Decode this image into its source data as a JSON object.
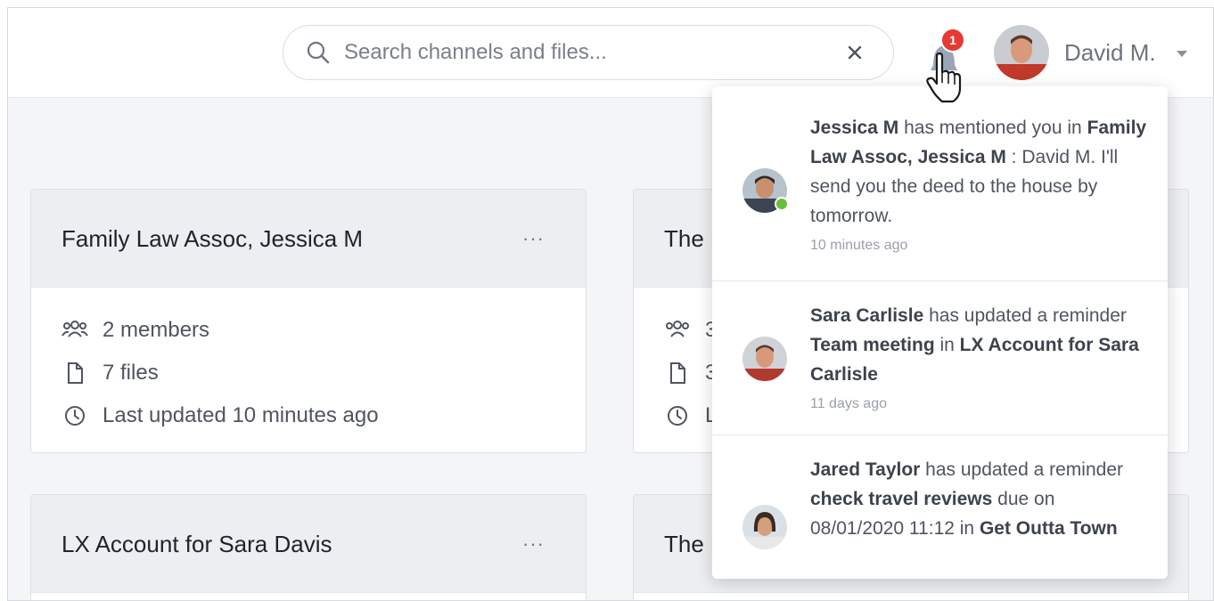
{
  "search": {
    "placeholder": "Search channels and files..."
  },
  "notifications": {
    "count": "1"
  },
  "user": {
    "name": "David M."
  },
  "cards": [
    {
      "title": "Family Law Assoc, Jessica M",
      "more": "···",
      "members": "2 members",
      "files": "7 files",
      "updated": "Last updated 10 minutes ago"
    },
    {
      "title": "The",
      "more": "···",
      "members": "3",
      "files": "3",
      "updated": "L"
    },
    {
      "title": "LX Account for Sara Davis",
      "more": "···"
    },
    {
      "title": "The"
    }
  ],
  "dropdown": {
    "items": [
      {
        "actor": "Jessica M",
        "t1": " has mentioned you in ",
        "target": "Family Law Assoc, Jessica M",
        "t2": " : David M. I'll send you the deed to the house by tomorrow.",
        "time": "10 minutes ago"
      },
      {
        "actor": "Sara Carlisle",
        "t1": " has updated a reminder ",
        "target": "Team meeting",
        "t2": " in ",
        "target2": "LX Account for Sara Carlisle",
        "time": "11 days ago"
      },
      {
        "actor": "Jared Taylor",
        "t1": " has updated a reminder ",
        "target": "check travel reviews",
        "t2": " due on 08/01/2020 11:12 in ",
        "target2": "Get Outta Town"
      }
    ]
  },
  "colors": {
    "badge": "#e53935",
    "online": "#6abf3a",
    "card_header": "#eceef1"
  },
  "icons": {
    "search": "search-icon",
    "clear": "close-icon",
    "bell": "bell-icon",
    "members": "people-icon",
    "files": "file-icon",
    "updated": "clock-icon"
  }
}
